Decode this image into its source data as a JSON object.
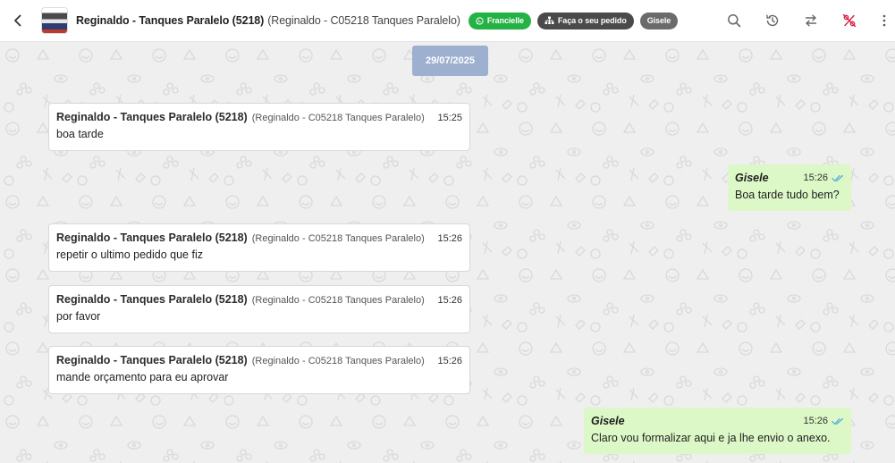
{
  "header": {
    "contact_name": "Reginaldo - Tanques Paralelo (5218)",
    "contact_sub": "(Reginaldo - C05218 Tanques Paralelo)",
    "tags": [
      {
        "label": "Francielle",
        "icon": "whatsapp-icon",
        "color": "#25b245"
      },
      {
        "label": "Faça o seu pedido",
        "icon": "sitemap-icon",
        "color": "#4a4a4a"
      },
      {
        "label": "Gisele",
        "color": "#6b6b6b"
      }
    ],
    "actions": [
      "search-icon",
      "history-icon",
      "transfer-icon",
      "percent-off-icon",
      "more-vertical-icon"
    ]
  },
  "chat": {
    "date": "29/07/2025",
    "messages": [
      {
        "direction": "in",
        "sender": "Reginaldo - Tanques Paralelo (5218)",
        "sender_sub": "(Reginaldo - C05218 Tanques Paralelo)",
        "time": "15:25",
        "text": "boa tarde"
      },
      {
        "direction": "out",
        "sender": "Gisele",
        "time": "15:26",
        "text": "Boa tarde tudo bem?",
        "status": "read"
      },
      {
        "direction": "in",
        "sender": "Reginaldo - Tanques Paralelo (5218)",
        "sender_sub": "(Reginaldo - C05218 Tanques Paralelo)",
        "time": "15:26",
        "text": "repetir o ultimo pedido que fiz"
      },
      {
        "direction": "in",
        "sender": "Reginaldo - Tanques Paralelo (5218)",
        "sender_sub": "(Reginaldo - C05218 Tanques Paralelo)",
        "time": "15:26",
        "text": "por favor"
      },
      {
        "direction": "in",
        "sender": "Reginaldo - Tanques Paralelo (5218)",
        "sender_sub": "(Reginaldo - C05218 Tanques Paralelo)",
        "time": "15:26",
        "text": "mande orçamento para eu aprovar"
      },
      {
        "direction": "out",
        "sender": "Gisele",
        "time": "15:26",
        "text": "Claro vou formalizar aqui e ja lhe envio o anexo.",
        "status": "read"
      }
    ]
  },
  "colors": {
    "chat_bg": "#efefef",
    "outgoing_bubble": "#dcf8c6",
    "date_chip": "#9db0d0",
    "read_ticks": "#4fa8e0",
    "percent_icon": "#d6234a"
  }
}
